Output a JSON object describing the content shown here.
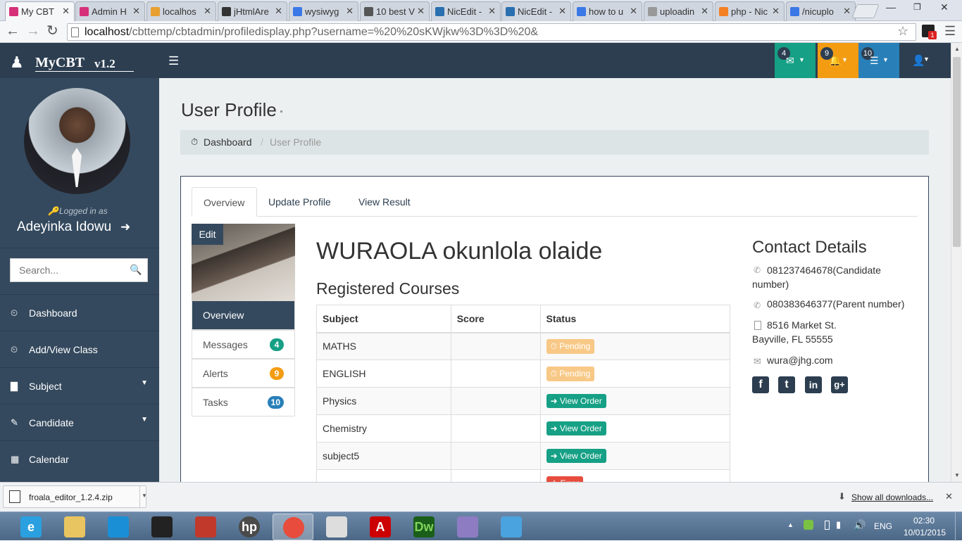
{
  "browser": {
    "tabs": [
      {
        "title": "My CBT",
        "icon": "instagram-icon",
        "color": "#d6307a",
        "active": true
      },
      {
        "title": "Admin H",
        "icon": "instagram-icon",
        "color": "#d6307a"
      },
      {
        "title": "localhos",
        "icon": "phpmyadmin-icon",
        "color": "#e8a030"
      },
      {
        "title": "jHtmlAre",
        "icon": "github-icon",
        "color": "#333333"
      },
      {
        "title": "wysiwyg",
        "icon": "google-icon",
        "color": "#3b78e7"
      },
      {
        "title": "10 best V",
        "icon": "text-icon",
        "color": "#555555"
      },
      {
        "title": "NicEdit -",
        "icon": "globe-icon",
        "color": "#2a6fb0"
      },
      {
        "title": "NicEdit -",
        "icon": "globe-icon",
        "color": "#2a6fb0"
      },
      {
        "title": "how to u",
        "icon": "google-icon",
        "color": "#3b78e7"
      },
      {
        "title": "uploadin",
        "icon": "page-icon",
        "color": "#999999"
      },
      {
        "title": "php - Nic",
        "icon": "stackoverflow-icon",
        "color": "#f48024"
      },
      {
        "title": "/nicuplo",
        "icon": "google-icon",
        "color": "#3b78e7"
      }
    ],
    "url_host": "localhost",
    "url_path": "/cbttemp/cbtadmin/profiledisplay.php?username=%20%20sKWjkw%3D%3D%20&",
    "extension_badge": "1"
  },
  "app": {
    "brand": "MyCBT",
    "version": "v1.2",
    "badges": [
      {
        "count": "4",
        "icon": "envelope-icon",
        "color": "#16a085"
      },
      {
        "count": "9",
        "icon": "bell-icon",
        "color": "#f39c12"
      },
      {
        "count": "10",
        "icon": "tasks-icon",
        "color": "#2980b9"
      }
    ]
  },
  "sidebar": {
    "logged_in_label": "Logged in as",
    "user_name": "Adeyinka Idowu",
    "search_placeholder": "Search...",
    "items": [
      {
        "label": "Dashboard",
        "icon": "dashboard-icon",
        "caret": false
      },
      {
        "label": "Add/View Class",
        "icon": "dashboard-icon",
        "caret": false
      },
      {
        "label": "Subject",
        "icon": "bar-chart-icon",
        "caret": true
      },
      {
        "label": "Candidate",
        "icon": "edit-icon",
        "caret": true
      },
      {
        "label": "Calendar",
        "icon": "calendar-icon",
        "caret": false
      }
    ]
  },
  "main": {
    "page_title": "User Profile",
    "breadcrumb": {
      "home": "Dashboard",
      "current": "User Profile"
    },
    "tabs": [
      "Overview",
      "Update Profile",
      "View Result"
    ],
    "edit_label": "Edit",
    "profile_menu": [
      {
        "label": "Overview",
        "active": true
      },
      {
        "label": "Messages",
        "count": "4",
        "color": "#16a085"
      },
      {
        "label": "Alerts",
        "count": "9",
        "color": "#f39c12"
      },
      {
        "label": "Tasks",
        "count": "10",
        "color": "#2980b9"
      }
    ],
    "candidate_name": "WURAOLA okunlola olaide",
    "courses_heading": "Registered Courses",
    "table": {
      "headers": [
        "Subject",
        "Score",
        "Status"
      ],
      "rows": [
        {
          "subject": "MATHS",
          "score": "",
          "status": "Pending",
          "kind": "warn"
        },
        {
          "subject": "ENGLISH",
          "score": "",
          "status": "Pending",
          "kind": "warn"
        },
        {
          "subject": "Physics",
          "score": "",
          "status": "View Order",
          "kind": "ok"
        },
        {
          "subject": "Chemistry",
          "score": "",
          "status": "View Order",
          "kind": "ok"
        },
        {
          "subject": "subject5",
          "score": "",
          "status": "View Order",
          "kind": "ok"
        },
        {
          "subject": "",
          "score": "",
          "status": "Error",
          "kind": "err"
        }
      ]
    },
    "contact": {
      "heading": "Contact Details",
      "phone1": "081237464678(Candidate number)",
      "phone2": "080383646377(Parent number)",
      "address_line1": "8516 Market St.",
      "address_line2": "Bayville, FL 55555",
      "email": "wura@jhg.com",
      "social": [
        "facebook-icon",
        "twitter-icon",
        "linkedin-icon",
        "google-plus-icon"
      ]
    }
  },
  "downloads": {
    "file": "froala_editor_1.2.4.zip",
    "show_all": "Show all downloads..."
  },
  "taskbar": {
    "apps": [
      "internet-explorer-icon",
      "file-explorer-icon",
      "rocket-icon",
      "camera-icon",
      "paint-icon",
      "hp-icon",
      "chrome-icon",
      "document-icon",
      "adobe-reader-icon",
      "dreamweaver-icon",
      "palette-icon",
      "image-viewer-icon"
    ],
    "lang": "ENG",
    "time": "02:30",
    "date": "10/01/2015"
  }
}
